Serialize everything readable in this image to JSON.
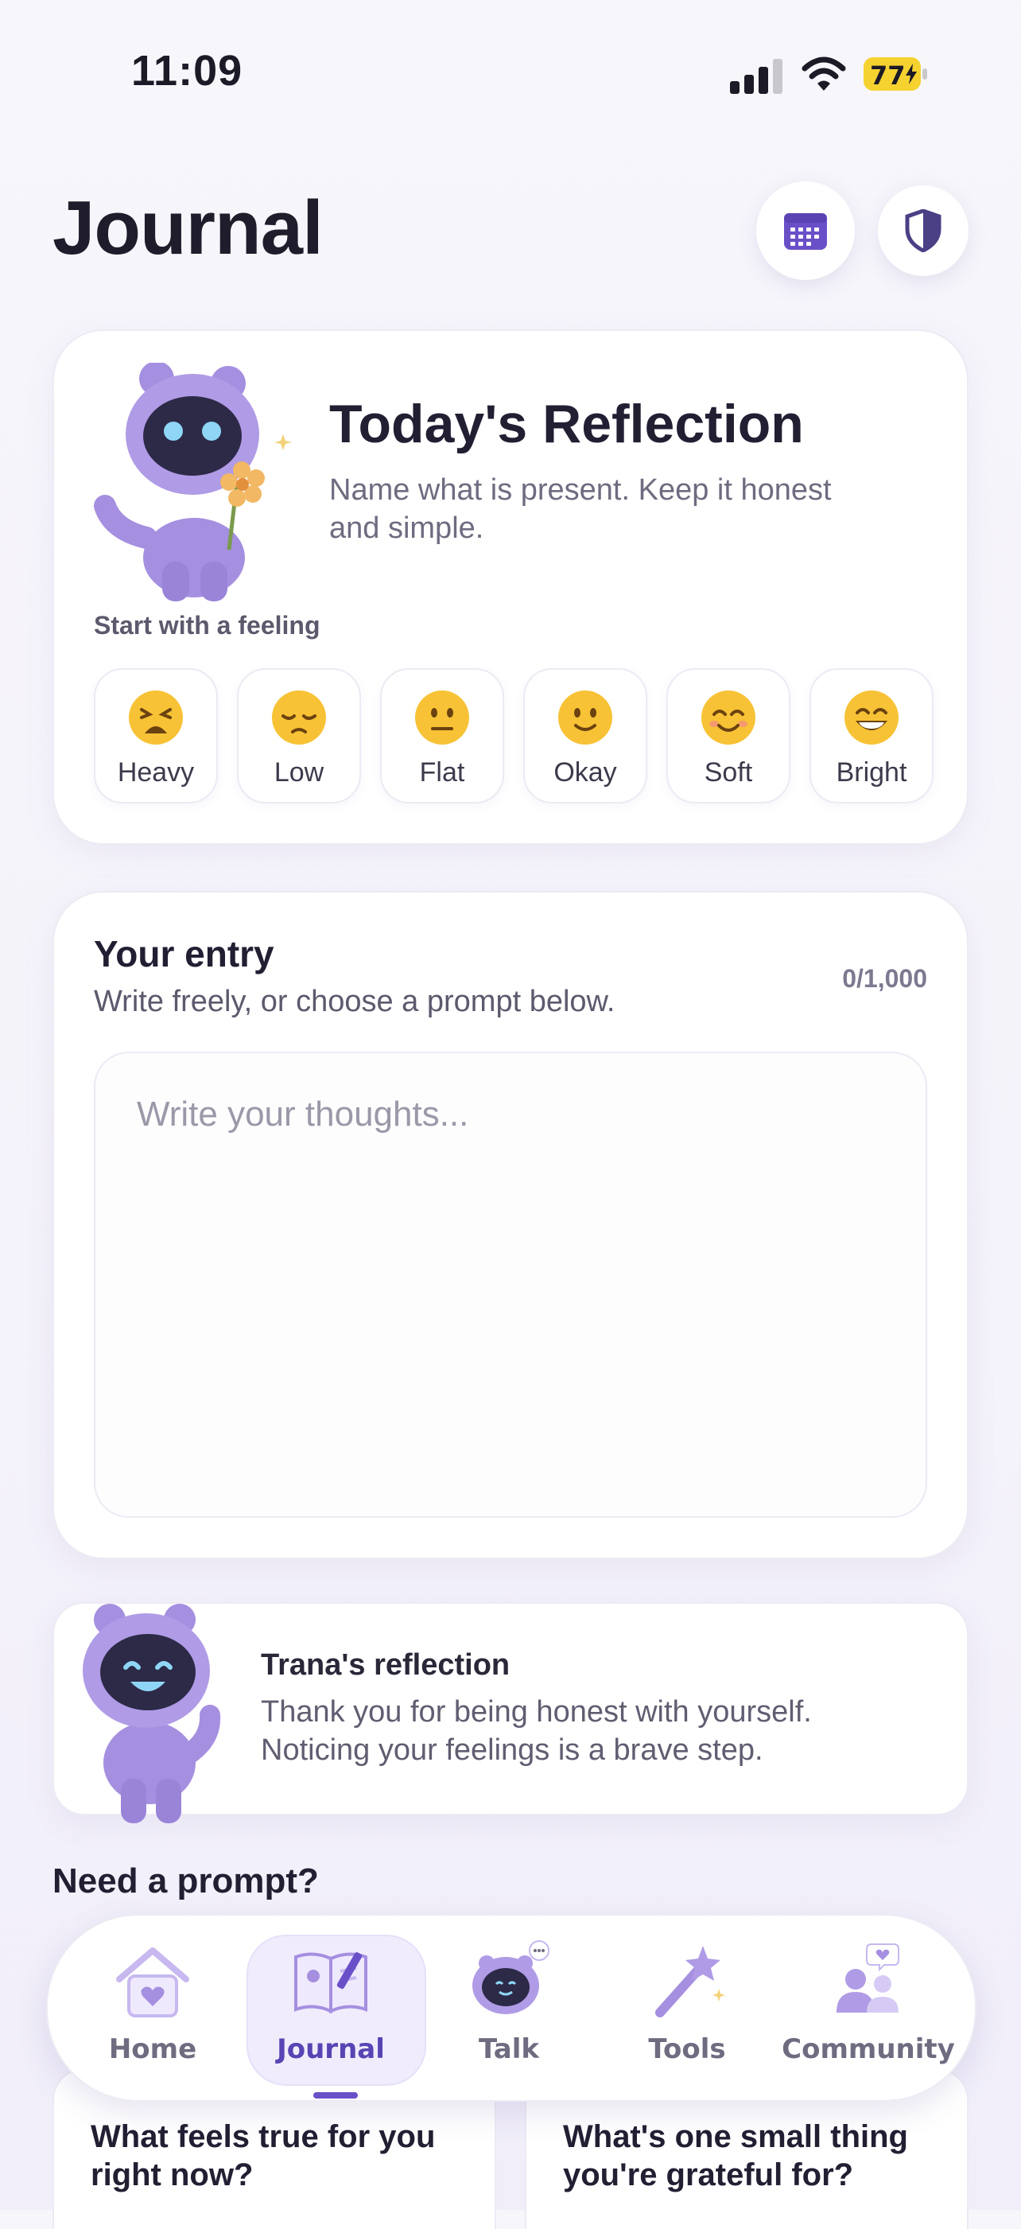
{
  "status_bar": {
    "time": "11:09",
    "battery": "77"
  },
  "header": {
    "title": "Journal",
    "calendar_icon": "calendar-icon",
    "shield_icon": "shield-icon"
  },
  "reflection": {
    "title": "Today's Reflection",
    "subtitle_line1": "Name what is present. Keep it honest",
    "subtitle_line2": "and simple.",
    "feeling_label": "Start with a feeling",
    "feelings": [
      {
        "label": "Heavy",
        "icon": "tired-face-icon"
      },
      {
        "label": "Low",
        "icon": "pensive-face-icon"
      },
      {
        "label": "Flat",
        "icon": "neutral-face-icon"
      },
      {
        "label": "Okay",
        "icon": "slight-smile-icon"
      },
      {
        "label": "Soft",
        "icon": "smiling-face-icon"
      },
      {
        "label": "Bright",
        "icon": "grinning-face-icon"
      }
    ]
  },
  "entry": {
    "title": "Your entry",
    "subtitle": "Write freely, or choose a prompt below.",
    "char_count": "0/1,000",
    "placeholder": "Write your thoughts..."
  },
  "trana": {
    "title": "Trana's reflection",
    "line1": "Thank you for being honest with yourself.",
    "line2": "Noticing your feelings is a brave step."
  },
  "prompts": {
    "heading": "Need a prompt?",
    "items": [
      {
        "line1": "What feels true for you",
        "line2": "right now?"
      },
      {
        "line1": "What's one small thing",
        "line2": "you're grateful for?"
      }
    ]
  },
  "tabbar": {
    "tabs": [
      {
        "label": "Home",
        "icon": "home-icon"
      },
      {
        "label": "Journal",
        "icon": "journal-icon"
      },
      {
        "label": "Talk",
        "icon": "talk-robot-icon"
      },
      {
        "label": "Tools",
        "icon": "magic-wand-icon"
      },
      {
        "label": "Community",
        "icon": "community-icon"
      }
    ]
  },
  "colors": {
    "accent": "#6a50c8",
    "mascot": "#a58fe0",
    "background": "#f6f5fb"
  }
}
